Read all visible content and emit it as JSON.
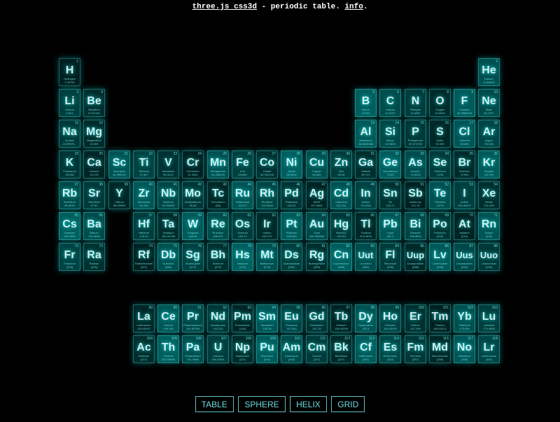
{
  "header": {
    "link_label": "three.js css3d",
    "middle_text": " - periodic table. ",
    "info_label": "info",
    "end_text": "."
  },
  "menu": {
    "buttons": [
      "TABLE",
      "SPHERE",
      "HELIX",
      "GRID"
    ]
  },
  "colors": {
    "tile_base": "#007f7f",
    "glow": "#00ffff",
    "text": "#7fffff"
  },
  "elements": [
    {
      "s": "H",
      "n": "Hydrogen",
      "m": "1.00794",
      "c": 1,
      "r": 1
    },
    {
      "s": "He",
      "n": "Helium",
      "m": "4.002602",
      "c": 18,
      "r": 1
    },
    {
      "s": "Li",
      "n": "Lithium",
      "m": "6.941",
      "c": 1,
      "r": 2
    },
    {
      "s": "Be",
      "n": "Beryllium",
      "m": "9.012182",
      "c": 2,
      "r": 2
    },
    {
      "s": "B",
      "n": "Boron",
      "m": "10.811",
      "c": 13,
      "r": 2
    },
    {
      "s": "C",
      "n": "Carbon",
      "m": "12.0107",
      "c": 14,
      "r": 2
    },
    {
      "s": "N",
      "n": "Nitrogen",
      "m": "14.0067",
      "c": 15,
      "r": 2
    },
    {
      "s": "O",
      "n": "Oxygen",
      "m": "15.9994",
      "c": 16,
      "r": 2
    },
    {
      "s": "F",
      "n": "Fluorine",
      "m": "18.9984032",
      "c": 17,
      "r": 2
    },
    {
      "s": "Ne",
      "n": "Neon",
      "m": "20.1797",
      "c": 18,
      "r": 2
    },
    {
      "s": "Na",
      "n": "Sodium",
      "m": "22.98976...",
      "c": 1,
      "r": 3
    },
    {
      "s": "Mg",
      "n": "Magnesium",
      "m": "24.305",
      "c": 2,
      "r": 3
    },
    {
      "s": "Al",
      "n": "Aluminium",
      "m": "26.9815386",
      "c": 13,
      "r": 3
    },
    {
      "s": "Si",
      "n": "Silicon",
      "m": "28.0855",
      "c": 14,
      "r": 3
    },
    {
      "s": "P",
      "n": "Phosphorus",
      "m": "30.973762",
      "c": 15,
      "r": 3
    },
    {
      "s": "S",
      "n": "Sulfur",
      "m": "32.065",
      "c": 16,
      "r": 3
    },
    {
      "s": "Cl",
      "n": "Chlorine",
      "m": "35.453",
      "c": 17,
      "r": 3
    },
    {
      "s": "Ar",
      "n": "Argon",
      "m": "39.948",
      "c": 18,
      "r": 3
    },
    {
      "s": "K",
      "n": "Potassium",
      "m": "39.948",
      "c": 1,
      "r": 4
    },
    {
      "s": "Ca",
      "n": "Calcium",
      "m": "40.078",
      "c": 2,
      "r": 4
    },
    {
      "s": "Sc",
      "n": "Scandium",
      "m": "44.955912",
      "c": 3,
      "r": 4
    },
    {
      "s": "Ti",
      "n": "Titanium",
      "m": "47.867",
      "c": 4,
      "r": 4
    },
    {
      "s": "V",
      "n": "Vanadium",
      "m": "50.9415",
      "c": 5,
      "r": 4
    },
    {
      "s": "Cr",
      "n": "Chromium",
      "m": "51.9961",
      "c": 6,
      "r": 4
    },
    {
      "s": "Mn",
      "n": "Manganese",
      "m": "54.938045",
      "c": 7,
      "r": 4
    },
    {
      "s": "Fe",
      "n": "Iron",
      "m": "55.845",
      "c": 8,
      "r": 4
    },
    {
      "s": "Co",
      "n": "Cobalt",
      "m": "58.933195",
      "c": 9,
      "r": 4
    },
    {
      "s": "Ni",
      "n": "Nickel",
      "m": "58.6934",
      "c": 10,
      "r": 4
    },
    {
      "s": "Cu",
      "n": "Copper",
      "m": "63.546",
      "c": 11,
      "r": 4
    },
    {
      "s": "Zn",
      "n": "Zinc",
      "m": "65.38",
      "c": 12,
      "r": 4
    },
    {
      "s": "Ga",
      "n": "Gallium",
      "m": "69.723",
      "c": 13,
      "r": 4
    },
    {
      "s": "Ge",
      "n": "Germanium",
      "m": "72.63",
      "c": 14,
      "r": 4
    },
    {
      "s": "As",
      "n": "Arsenic",
      "m": "74.9216",
      "c": 15,
      "r": 4
    },
    {
      "s": "Se",
      "n": "Selenium",
      "m": "78.96",
      "c": 16,
      "r": 4
    },
    {
      "s": "Br",
      "n": "Bromine",
      "m": "79.904",
      "c": 17,
      "r": 4
    },
    {
      "s": "Kr",
      "n": "Krypton",
      "m": "83.798",
      "c": 18,
      "r": 4
    },
    {
      "s": "Rb",
      "n": "Rubidium",
      "m": "85.4678",
      "c": 1,
      "r": 5
    },
    {
      "s": "Sr",
      "n": "Strontium",
      "m": "87.62",
      "c": 2,
      "r": 5
    },
    {
      "s": "Y",
      "n": "Yttrium",
      "m": "88.90585",
      "c": 3,
      "r": 5
    },
    {
      "s": "Zr",
      "n": "Zirconium",
      "m": "91.224",
      "c": 4,
      "r": 5
    },
    {
      "s": "Nb",
      "n": "Niobium",
      "m": "92.90628",
      "c": 5,
      "r": 5
    },
    {
      "s": "Mo",
      "n": "Molybdenum",
      "m": "95.96",
      "c": 6,
      "r": 5
    },
    {
      "s": "Tc",
      "n": "Technetium",
      "m": "(98)",
      "c": 7,
      "r": 5
    },
    {
      "s": "Ru",
      "n": "Ruthenium",
      "m": "101.07",
      "c": 8,
      "r": 5
    },
    {
      "s": "Rh",
      "n": "Rhodium",
      "m": "102.9055",
      "c": 9,
      "r": 5
    },
    {
      "s": "Pd",
      "n": "Palladium",
      "m": "106.42",
      "c": 10,
      "r": 5
    },
    {
      "s": "Ag",
      "n": "Silver",
      "m": "107.8682",
      "c": 11,
      "r": 5
    },
    {
      "s": "Cd",
      "n": "Cadmium",
      "m": "112.411",
      "c": 12,
      "r": 5
    },
    {
      "s": "In",
      "n": "Indium",
      "m": "114.818",
      "c": 13,
      "r": 5
    },
    {
      "s": "Sn",
      "n": "Tin",
      "m": "118.71",
      "c": 14,
      "r": 5
    },
    {
      "s": "Sb",
      "n": "Antimony",
      "m": "121.76",
      "c": 15,
      "r": 5
    },
    {
      "s": "Te",
      "n": "Tellurium",
      "m": "127.6",
      "c": 16,
      "r": 5
    },
    {
      "s": "I",
      "n": "Iodine",
      "m": "126.90447",
      "c": 17,
      "r": 5
    },
    {
      "s": "Xe",
      "n": "Xenon",
      "m": "131.293",
      "c": 18,
      "r": 5
    },
    {
      "s": "Cs",
      "n": "Caesium",
      "m": "132.9054",
      "c": 1,
      "r": 6
    },
    {
      "s": "Ba",
      "n": "Barium",
      "m": "132.9054",
      "c": 2,
      "r": 6
    },
    {
      "s": "Hf",
      "n": "Hafnium",
      "m": "178.49",
      "c": 4,
      "r": 6
    },
    {
      "s": "Ta",
      "n": "Tantalum",
      "m": "180.94788",
      "c": 5,
      "r": 6
    },
    {
      "s": "W",
      "n": "Tungsten",
      "m": "183.84",
      "c": 6,
      "r": 6
    },
    {
      "s": "Re",
      "n": "Rhenium",
      "m": "186.207",
      "c": 7,
      "r": 6
    },
    {
      "s": "Os",
      "n": "Osmium",
      "m": "190.23",
      "c": 8,
      "r": 6
    },
    {
      "s": "Ir",
      "n": "Iridium",
      "m": "192.217",
      "c": 9,
      "r": 6
    },
    {
      "s": "Pt",
      "n": "Platinum",
      "m": "195.084",
      "c": 10,
      "r": 6
    },
    {
      "s": "Au",
      "n": "Gold",
      "m": "196.966569",
      "c": 11,
      "r": 6
    },
    {
      "s": "Hg",
      "n": "Mercury",
      "m": "200.59",
      "c": 12,
      "r": 6
    },
    {
      "s": "Tl",
      "n": "Thallium",
      "m": "204.3833",
      "c": 13,
      "r": 6
    },
    {
      "s": "Pb",
      "n": "Lead",
      "m": "207.2",
      "c": 14,
      "r": 6
    },
    {
      "s": "Bi",
      "n": "Bismuth",
      "m": "208.9804",
      "c": 15,
      "r": 6
    },
    {
      "s": "Po",
      "n": "Polonium",
      "m": "(209)",
      "c": 16,
      "r": 6
    },
    {
      "s": "At",
      "n": "Astatine",
      "m": "(210)",
      "c": 17,
      "r": 6
    },
    {
      "s": "Rn",
      "n": "Radon",
      "m": "(222)",
      "c": 18,
      "r": 6
    },
    {
      "s": "Fr",
      "n": "Francium",
      "m": "(223)",
      "c": 1,
      "r": 7
    },
    {
      "s": "Ra",
      "n": "Radium",
      "m": "(226)",
      "c": 2,
      "r": 7
    },
    {
      "s": "Rf",
      "n": "Rutherfordium",
      "m": "(267)",
      "c": 4,
      "r": 7
    },
    {
      "s": "Db",
      "n": "Dubnium",
      "m": "(268)",
      "c": 5,
      "r": 7
    },
    {
      "s": "Sg",
      "n": "Seaborgium",
      "m": "(271)",
      "c": 6,
      "r": 7
    },
    {
      "s": "Bh",
      "n": "Bohrium",
      "m": "(272)",
      "c": 7,
      "r": 7
    },
    {
      "s": "Hs",
      "n": "Hassium",
      "m": "(270)",
      "c": 8,
      "r": 7
    },
    {
      "s": "Mt",
      "n": "Meitnerium",
      "m": "(276)",
      "c": 9,
      "r": 7
    },
    {
      "s": "Ds",
      "n": "Darmstadium",
      "m": "(281)",
      "c": 10,
      "r": 7
    },
    {
      "s": "Rg",
      "n": "Roentgenium",
      "m": "(280)",
      "c": 11,
      "r": 7
    },
    {
      "s": "Cn",
      "n": "Copernicium",
      "m": "(285)",
      "c": 12,
      "r": 7
    },
    {
      "s": "Uut",
      "n": "Unutrium",
      "m": "(284)",
      "c": 13,
      "r": 7
    },
    {
      "s": "Fl",
      "n": "Flerovium",
      "m": "(289)",
      "c": 14,
      "r": 7
    },
    {
      "s": "Uup",
      "n": "Ununpentium",
      "m": "(288)",
      "c": 15,
      "r": 7
    },
    {
      "s": "Lv",
      "n": "Livermorium",
      "m": "(293)",
      "c": 16,
      "r": 7
    },
    {
      "s": "Uus",
      "n": "Ununseptium",
      "m": "(294)",
      "c": 17,
      "r": 7
    },
    {
      "s": "Uuo",
      "n": "Ununoctium",
      "m": "(294)",
      "c": 18,
      "r": 7
    },
    {
      "s": "La",
      "n": "Lanthanum",
      "m": "138.90547",
      "c": 4,
      "r": 9
    },
    {
      "s": "Ce",
      "n": "Cerium",
      "m": "140.116",
      "c": 5,
      "r": 9
    },
    {
      "s": "Pr",
      "n": "Praseodymium",
      "m": "140.90765",
      "c": 6,
      "r": 9
    },
    {
      "s": "Nd",
      "n": "Neodymium",
      "m": "144.242",
      "c": 7,
      "r": 9
    },
    {
      "s": "Pm",
      "n": "Promethium",
      "m": "(145)",
      "c": 8,
      "r": 9
    },
    {
      "s": "Sm",
      "n": "Samarium",
      "m": "150.36",
      "c": 9,
      "r": 9
    },
    {
      "s": "Eu",
      "n": "Europium",
      "m": "151.964",
      "c": 10,
      "r": 9
    },
    {
      "s": "Gd",
      "n": "Gadolinium",
      "m": "157.25",
      "c": 11,
      "r": 9
    },
    {
      "s": "Tb",
      "n": "Terbium",
      "m": "158.92535",
      "c": 12,
      "r": 9
    },
    {
      "s": "Dy",
      "n": "Dysprosium",
      "m": "162.5",
      "c": 13,
      "r": 9
    },
    {
      "s": "Ho",
      "n": "Holmium",
      "m": "164.93032",
      "c": 14,
      "r": 9
    },
    {
      "s": "Er",
      "n": "Erbium",
      "m": "167.259",
      "c": 15,
      "r": 9
    },
    {
      "s": "Tm",
      "n": "Thulium",
      "m": "168.93421",
      "c": 16,
      "r": 9
    },
    {
      "s": "Yb",
      "n": "Ytterbium",
      "m": "173.054",
      "c": 17,
      "r": 9
    },
    {
      "s": "Lu",
      "n": "Lutetium",
      "m": "174.9668",
      "c": 18,
      "r": 9
    },
    {
      "s": "Ac",
      "n": "Actinium",
      "m": "(227)",
      "c": 4,
      "r": 10
    },
    {
      "s": "Th",
      "n": "Thorium",
      "m": "232.03806",
      "c": 5,
      "r": 10
    },
    {
      "s": "Pa",
      "n": "Protactinium",
      "m": "231.0588",
      "c": 6,
      "r": 10
    },
    {
      "s": "U",
      "n": "Uranium",
      "m": "238.02891",
      "c": 7,
      "r": 10
    },
    {
      "s": "Np",
      "n": "Neptunium",
      "m": "(237)",
      "c": 8,
      "r": 10
    },
    {
      "s": "Pu",
      "n": "Plutonium",
      "m": "(244)",
      "c": 9,
      "r": 10
    },
    {
      "s": "Am",
      "n": "Americium",
      "m": "(243)",
      "c": 10,
      "r": 10
    },
    {
      "s": "Cm",
      "n": "Curium",
      "m": "(247)",
      "c": 11,
      "r": 10
    },
    {
      "s": "Bk",
      "n": "Berkelium",
      "m": "(247)",
      "c": 12,
      "r": 10
    },
    {
      "s": "Cf",
      "n": "Californium",
      "m": "(251)",
      "c": 13,
      "r": 10
    },
    {
      "s": "Es",
      "n": "Einstenium",
      "m": "(252)",
      "c": 14,
      "r": 10
    },
    {
      "s": "Fm",
      "n": "Fermium",
      "m": "(257)",
      "c": 15,
      "r": 10
    },
    {
      "s": "Md",
      "n": "Mendelevium",
      "m": "(258)",
      "c": 16,
      "r": 10
    },
    {
      "s": "No",
      "n": "Nobelium",
      "m": "(259)",
      "c": 17,
      "r": 10
    },
    {
      "s": "Lr",
      "n": "Lawrencium",
      "m": "(262)",
      "c": 18,
      "r": 10
    }
  ]
}
